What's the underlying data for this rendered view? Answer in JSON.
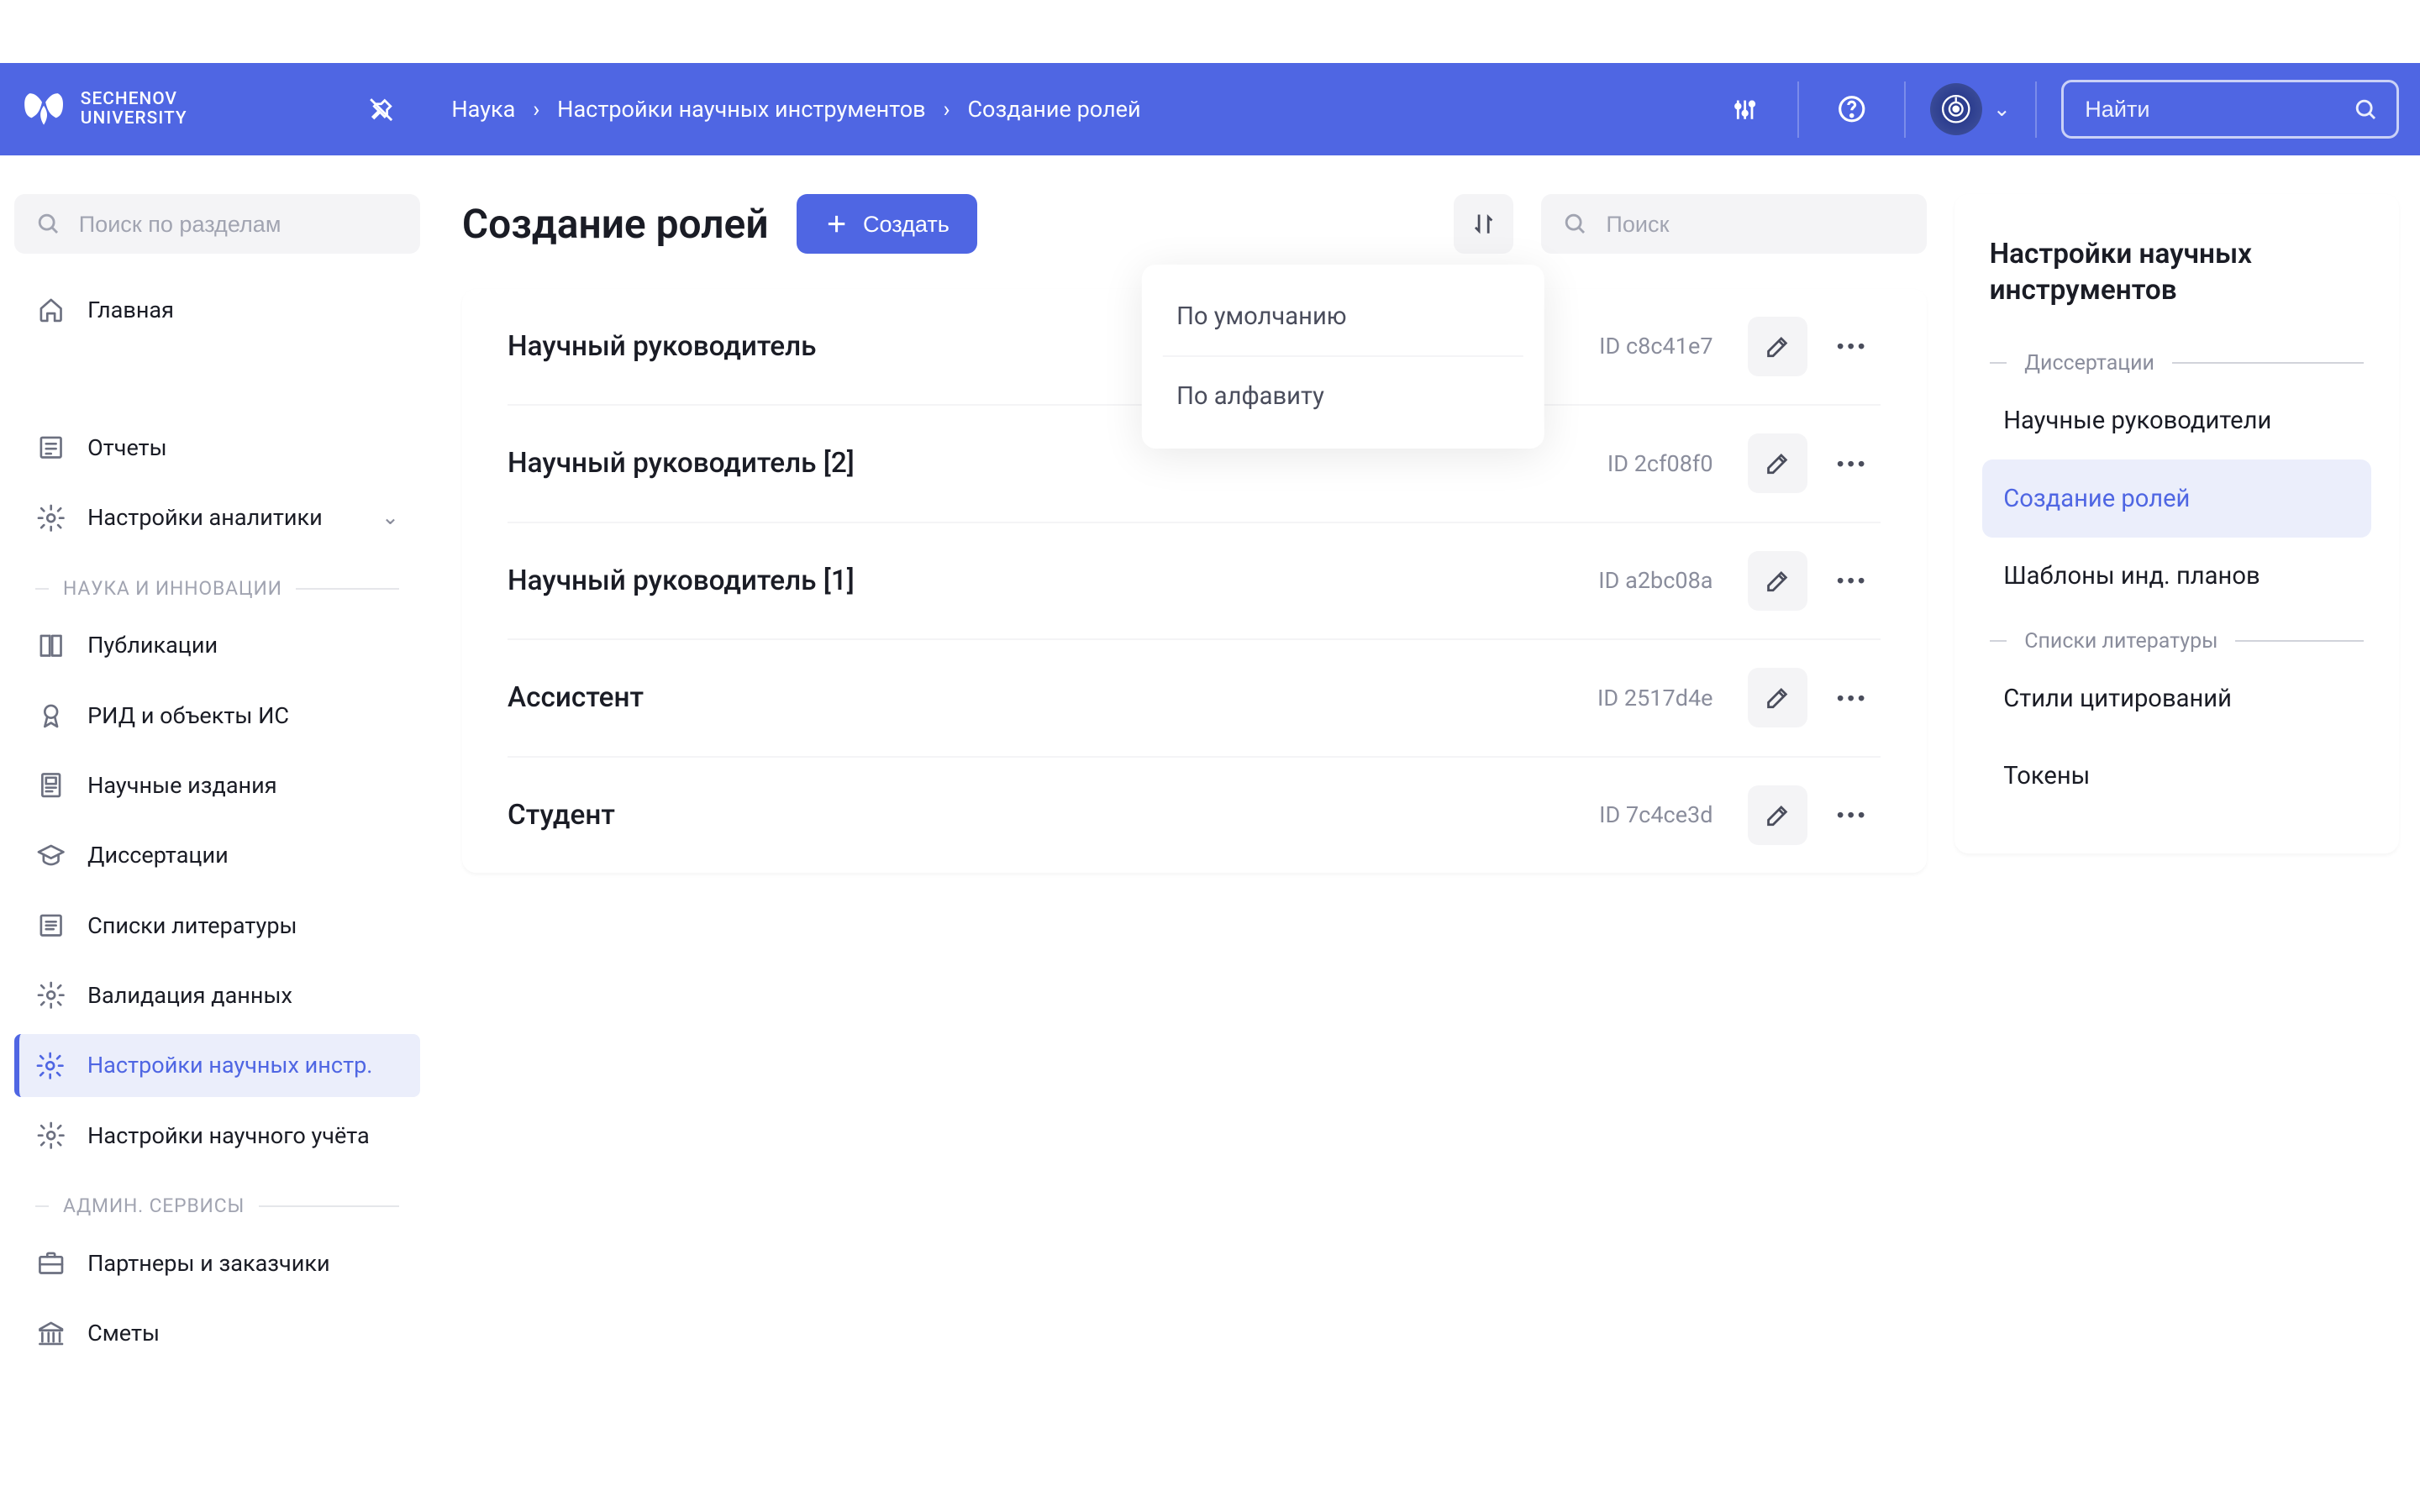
{
  "header": {
    "university_line1": "SECHENOV",
    "university_line2": "UNIVERSITY",
    "breadcrumbs": [
      "Наука",
      "Настройки научных инструментов",
      "Создание ролей"
    ],
    "search_placeholder": "Найти"
  },
  "sidebar": {
    "search_placeholder": "Поиск по разделам",
    "top_items": [
      {
        "label": "Главная",
        "icon": "home"
      },
      {
        "label": "Отчеты",
        "icon": "report"
      },
      {
        "label": "Настройки аналитики",
        "icon": "gear",
        "has_chevron": true
      }
    ],
    "section1_label": "НАУКА И ИННОВАЦИИ",
    "sci_items": [
      {
        "label": "Публикации",
        "icon": "book"
      },
      {
        "label": "РИД и объекты ИС",
        "icon": "award"
      },
      {
        "label": "Научные издания",
        "icon": "journal"
      },
      {
        "label": "Диссертации",
        "icon": "cap"
      },
      {
        "label": "Списки литературы",
        "icon": "list"
      },
      {
        "label": "Валидация данных",
        "icon": "gear"
      },
      {
        "label": "Настройки научных инстр.",
        "icon": "gear",
        "active": true
      },
      {
        "label": "Настройки научного учёта",
        "icon": "gear"
      }
    ],
    "section2_label": "АДМИН. СЕРВИСЫ",
    "admin_items": [
      {
        "label": "Партнеры и заказчики",
        "icon": "briefcase"
      },
      {
        "label": "Сметы",
        "icon": "bank"
      }
    ]
  },
  "page": {
    "title": "Создание ролей",
    "create_label": "Создать",
    "search_placeholder": "Поиск",
    "sort_options": [
      "По умолчанию",
      "По алфавиту"
    ],
    "roles": [
      {
        "name": "Научный руководитель",
        "id": "ID c8c41e7"
      },
      {
        "name": "Научный руководитель [2]",
        "id": "ID 2cf08f0"
      },
      {
        "name": "Научный руководитель [1]",
        "id": "ID a2bc08a"
      },
      {
        "name": "Ассистент",
        "id": "ID 2517d4e"
      },
      {
        "name": "Студент",
        "id": "ID 7c4ce3d"
      }
    ]
  },
  "right_panel": {
    "title": "Настройки научных инструментов",
    "sections": [
      {
        "label": "Диссертации",
        "items": [
          {
            "label": "Научные руководители"
          },
          {
            "label": "Создание ролей",
            "active": true
          },
          {
            "label": "Шаблоны инд. планов"
          }
        ]
      },
      {
        "label": "Списки литературы",
        "items": [
          {
            "label": "Стили цитирований"
          },
          {
            "label": "Токены"
          }
        ]
      }
    ]
  }
}
